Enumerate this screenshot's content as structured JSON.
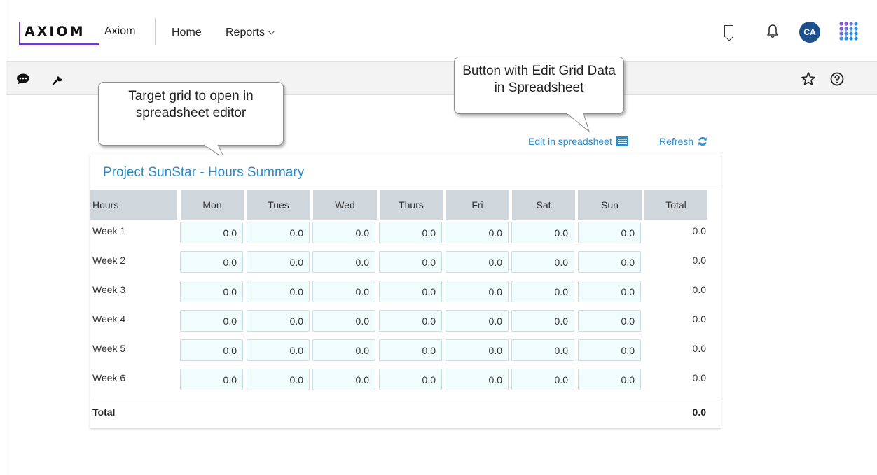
{
  "header": {
    "logo_text": "AXIOM",
    "app_name": "Axiom",
    "nav_home": "Home",
    "nav_reports": "Reports",
    "avatar_initials": "CA"
  },
  "callouts": {
    "grid": "Target grid to open in spreadsheet editor",
    "button": "Button with Edit Grid Data in Spreadsheet"
  },
  "actions": {
    "edit_label": "Edit in spreadsheet",
    "refresh_label": "Refresh"
  },
  "grid": {
    "title": "Project SunStar - Hours Summary",
    "columns": [
      "Hours",
      "Mon",
      "Tues",
      "Wed",
      "Thurs",
      "Fri",
      "Sat",
      "Sun",
      "Total"
    ],
    "rows": [
      {
        "label": "Week 1",
        "values": [
          "0.0",
          "0.0",
          "0.0",
          "0.0",
          "0.0",
          "0.0",
          "0.0"
        ],
        "total": "0.0"
      },
      {
        "label": "Week 2",
        "values": [
          "0.0",
          "0.0",
          "0.0",
          "0.0",
          "0.0",
          "0.0",
          "0.0"
        ],
        "total": "0.0"
      },
      {
        "label": "Week 3",
        "values": [
          "0.0",
          "0.0",
          "0.0",
          "0.0",
          "0.0",
          "0.0",
          "0.0"
        ],
        "total": "0.0"
      },
      {
        "label": "Week 4",
        "values": [
          "0.0",
          "0.0",
          "0.0",
          "0.0",
          "0.0",
          "0.0",
          "0.0"
        ],
        "total": "0.0"
      },
      {
        "label": "Week 5",
        "values": [
          "0.0",
          "0.0",
          "0.0",
          "0.0",
          "0.0",
          "0.0",
          "0.0"
        ],
        "total": "0.0"
      },
      {
        "label": "Week 6",
        "values": [
          "0.0",
          "0.0",
          "0.0",
          "0.0",
          "0.0",
          "0.0",
          "0.0"
        ],
        "total": "0.0"
      }
    ],
    "footer_label": "Total",
    "footer_total": "0.0"
  },
  "icons": {
    "toolbar": [
      "comment-icon",
      "wrench-icon"
    ],
    "toolbar_right": [
      "star-icon",
      "help-icon"
    ],
    "header_right": [
      "bookmark-icon",
      "bell-icon",
      "apps-grid-icon"
    ]
  },
  "colors": {
    "accent": "#2a8bc9",
    "header_row": "#cfd6dc",
    "cell_bg": "#f1fdfd",
    "avatar": "#1f4f8b",
    "logo_purple": "#6a3fc4"
  }
}
